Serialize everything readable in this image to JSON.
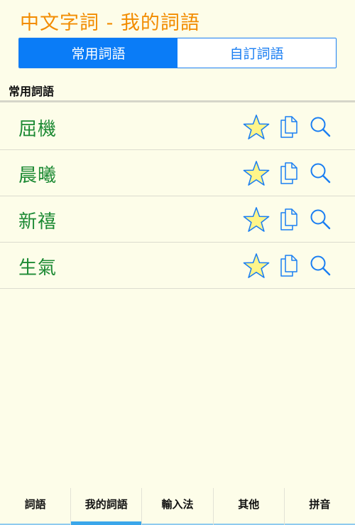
{
  "header": {
    "title": "中文字詞 - 我的詞語"
  },
  "segment": {
    "tabs": [
      "常用詞語",
      "自訂詞語"
    ],
    "active_index": 0
  },
  "section": {
    "title": "常用詞語"
  },
  "words": [
    {
      "text": "屈機"
    },
    {
      "text": "晨曦"
    },
    {
      "text": "新禧"
    },
    {
      "text": "生氣"
    }
  ],
  "icons": {
    "star": "star-icon",
    "copy": "copy-icon",
    "search": "search-icon"
  },
  "colors": {
    "title": "#f28c00",
    "accent": "#0a7cf7",
    "word": "#1d8a34",
    "star_fill": "#fff58a",
    "icon_stroke": "#1a7ef2",
    "background": "#fdfde9"
  },
  "tabbar": {
    "tabs": [
      "詞語",
      "我的詞語",
      "輸入法",
      "其他",
      "拼音"
    ],
    "active_index": 1
  }
}
